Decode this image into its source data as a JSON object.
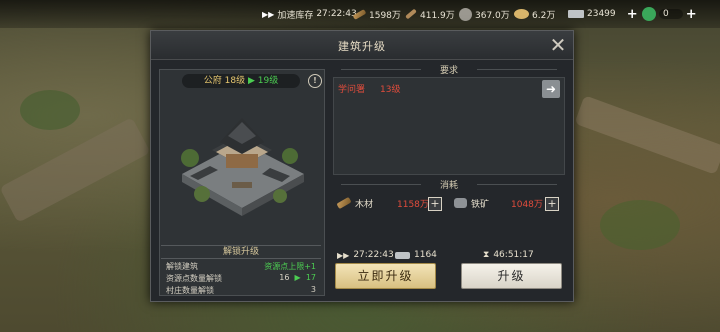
{
  "topbar": {
    "accelerate_label": "加速库存",
    "accelerate_time": "27:22:43",
    "resources": [
      {
        "icon": "wood-icon",
        "value": "1598万"
      },
      {
        "icon": "iron-icon",
        "value": "411.9万"
      },
      {
        "icon": "stone-icon",
        "value": "367.0万"
      },
      {
        "icon": "grain-icon",
        "value": "6.2万"
      },
      {
        "icon": "copper-icon",
        "value": "23499"
      },
      {
        "icon": "jade-icon",
        "value": "0"
      }
    ]
  },
  "modal": {
    "title": "建筑升级",
    "building": {
      "name": "公府",
      "level_from": "18级",
      "level_to": "19级"
    },
    "unlock": {
      "title": "解锁升级",
      "rows": [
        {
          "label": "解锁建筑",
          "value": "资源点上限+1"
        },
        {
          "label": "资源点数量解锁",
          "from": "16",
          "to": "17"
        },
        {
          "label": "村庄数量解锁",
          "value": "3"
        }
      ]
    },
    "requirements": {
      "title": "要求",
      "items": [
        {
          "name": "学问署",
          "level": "13级"
        }
      ]
    },
    "costs": {
      "title": "消耗",
      "items": [
        {
          "icon": "wood-icon",
          "name": "木材",
          "amount": "1158万"
        },
        {
          "icon": "iron-ore-icon",
          "name": "铁矿",
          "amount": "1048万"
        }
      ]
    },
    "stats": {
      "speedup_time": "27:22:43",
      "copper": "1164",
      "duration": "46:51:17"
    },
    "buttons": {
      "instant": "立即升级",
      "upgrade": "升级"
    }
  }
}
